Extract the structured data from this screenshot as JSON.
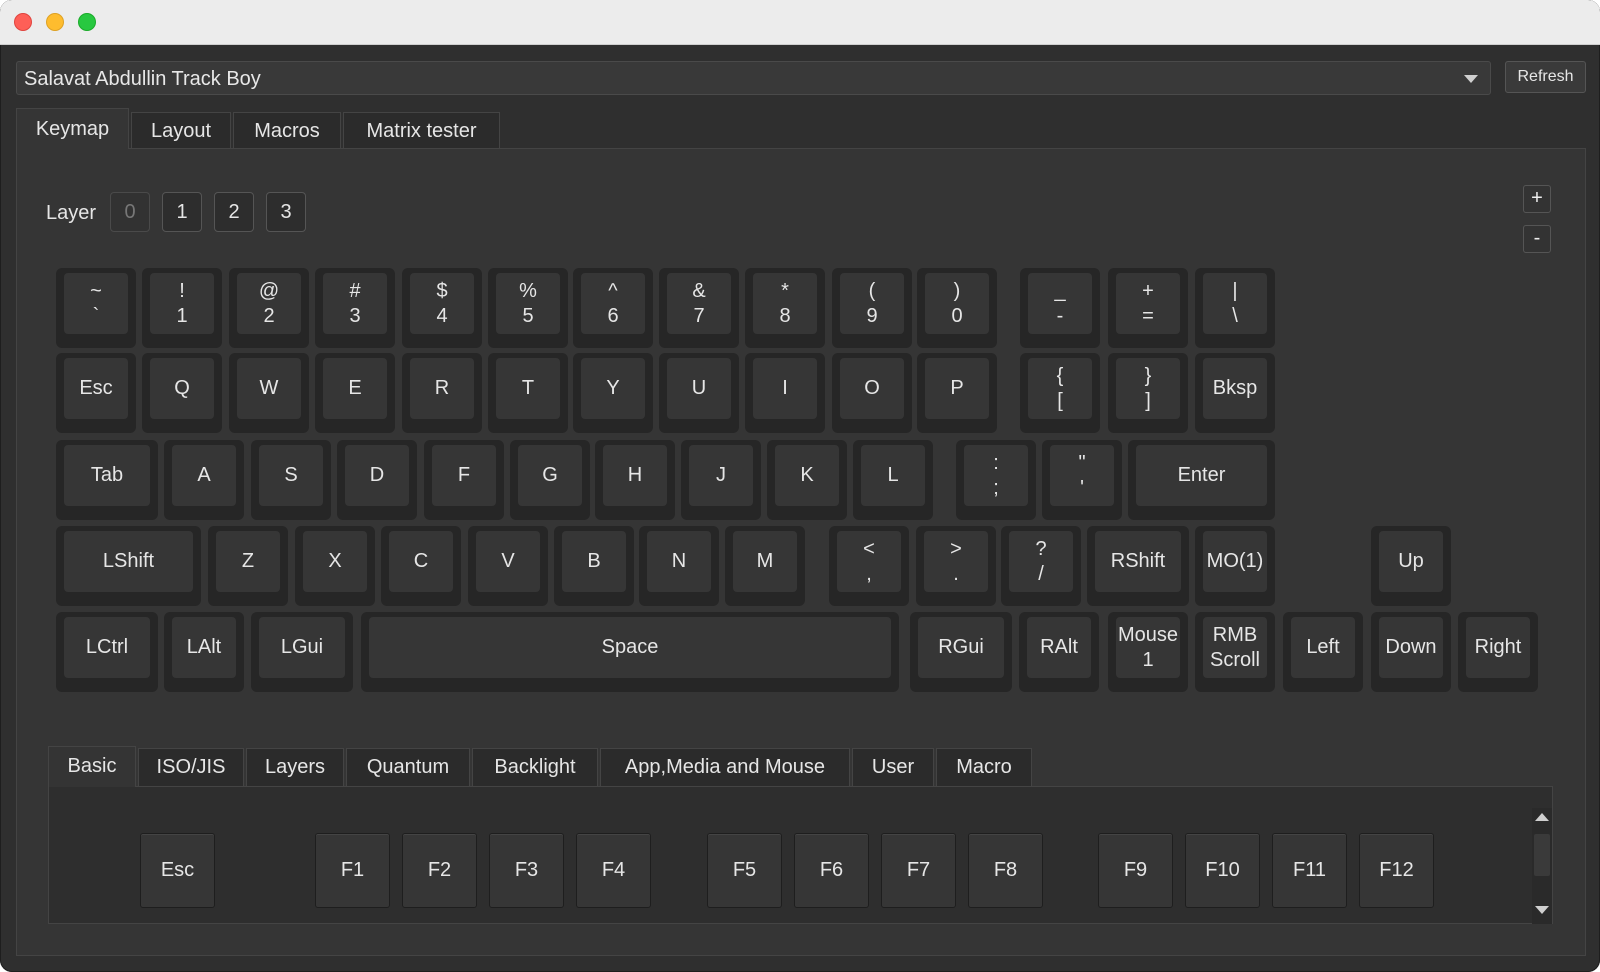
{
  "window": {
    "controls": [
      "close",
      "minimize",
      "zoom"
    ]
  },
  "device_selector": {
    "value": "Salavat Abdullin Track Boy",
    "refresh_label": "Refresh"
  },
  "main_tabs": [
    "Keymap",
    "Layout",
    "Macros",
    "Matrix tester"
  ],
  "layer": {
    "label": "Layer",
    "buttons": [
      "0",
      "1",
      "2",
      "3"
    ],
    "active": "0"
  },
  "zoom": {
    "plus": "+",
    "minus": "-"
  },
  "keyboard": {
    "rows": [
      [
        [
          "~",
          "`"
        ],
        [
          "!",
          "1"
        ],
        [
          "@",
          "2"
        ],
        [
          "#",
          "3"
        ],
        [
          "$",
          "4"
        ],
        [
          "%",
          "5"
        ],
        [
          "^",
          "6"
        ],
        [
          "&",
          "7"
        ],
        [
          "*",
          "8"
        ],
        [
          "(",
          "9"
        ],
        [
          ")",
          "0"
        ],
        [
          "_",
          "-"
        ],
        [
          "+",
          "="
        ],
        [
          "|",
          "\\"
        ]
      ],
      [
        [
          "Esc"
        ],
        [
          "Q"
        ],
        [
          "W"
        ],
        [
          "E"
        ],
        [
          "R"
        ],
        [
          "T"
        ],
        [
          "Y"
        ],
        [
          "U"
        ],
        [
          "I"
        ],
        [
          "O"
        ],
        [
          "P"
        ],
        [
          "{",
          "["
        ],
        [
          "}",
          "]"
        ],
        [
          "Bksp"
        ]
      ],
      [
        [
          "Tab"
        ],
        [
          "A"
        ],
        [
          "S"
        ],
        [
          "D"
        ],
        [
          "F"
        ],
        [
          "G"
        ],
        [
          "H"
        ],
        [
          "J"
        ],
        [
          "K"
        ],
        [
          "L"
        ],
        [
          ":",
          ";"
        ],
        [
          "\"",
          "'"
        ],
        [
          "Enter"
        ]
      ],
      [
        [
          "LShift"
        ],
        [
          "Z"
        ],
        [
          "X"
        ],
        [
          "C"
        ],
        [
          "V"
        ],
        [
          "B"
        ],
        [
          "N"
        ],
        [
          "M"
        ],
        [
          "<",
          ","
        ],
        [
          ">",
          "."
        ],
        [
          "?",
          "/"
        ],
        [
          "RShift"
        ],
        [
          "MO(1)"
        ],
        [
          "Up"
        ]
      ],
      [
        [
          "LCtrl"
        ],
        [
          "LAlt"
        ],
        [
          "LGui"
        ],
        [
          "Space"
        ],
        [
          "RGui"
        ],
        [
          "RAlt"
        ],
        [
          "Mouse",
          "1"
        ],
        [
          "RMB",
          "Scroll"
        ],
        [
          "Left"
        ],
        [
          "Down"
        ],
        [
          "Right"
        ]
      ]
    ]
  },
  "keycode_tabs": [
    "Basic",
    "ISO/JIS",
    "Layers",
    "Quantum",
    "Backlight",
    "App,Media and Mouse",
    "User",
    "Macro"
  ],
  "keycode_keys": [
    "Esc",
    "F1",
    "F2",
    "F3",
    "F4",
    "F5",
    "F6",
    "F7",
    "F8",
    "F9",
    "F10",
    "F11",
    "F12"
  ]
}
